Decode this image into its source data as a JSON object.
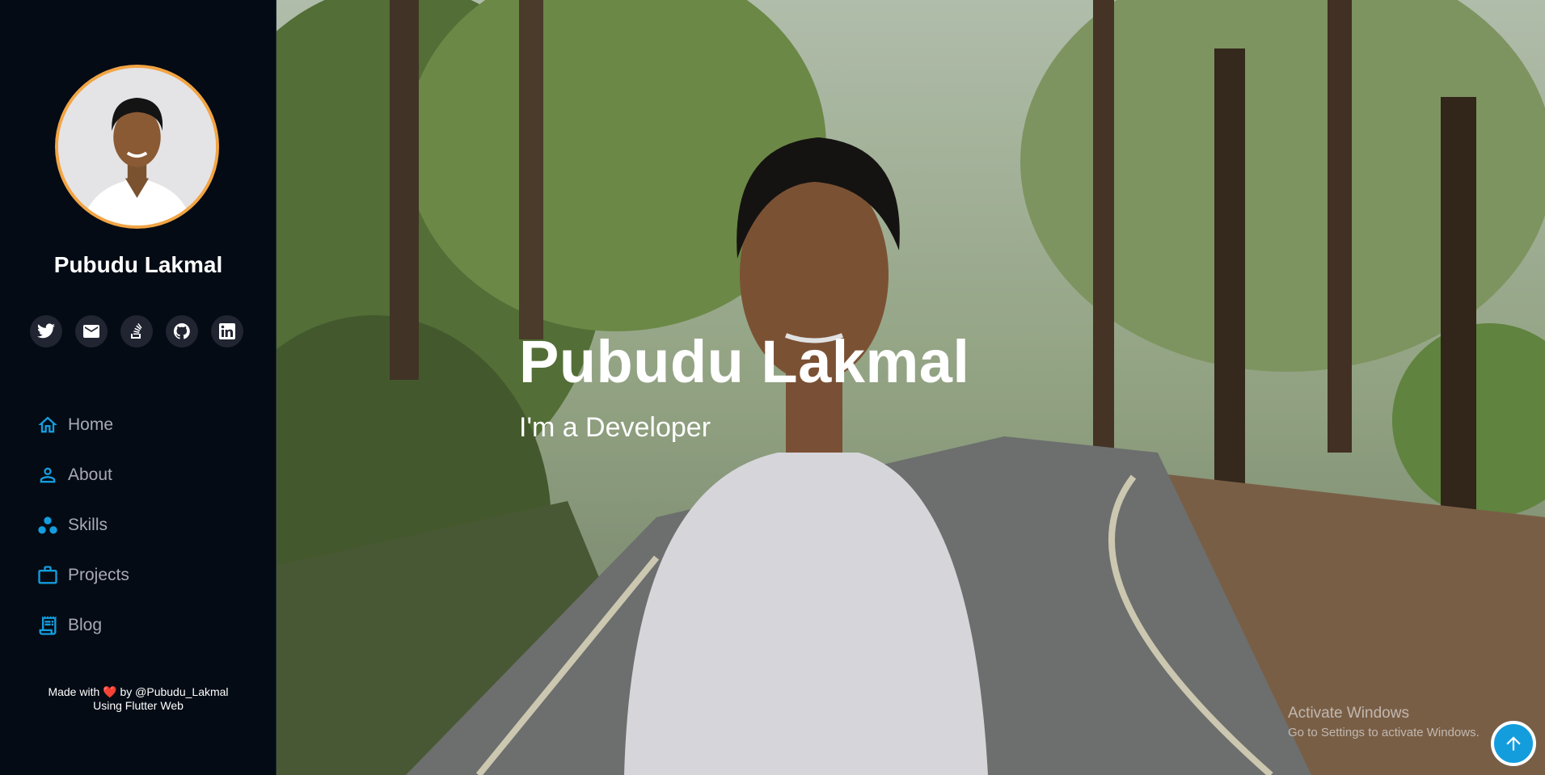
{
  "profile": {
    "name": "Pubudu Lakmal"
  },
  "social": [
    {
      "name": "twitter",
      "icon": "twitter-icon"
    },
    {
      "name": "email",
      "icon": "mail-icon"
    },
    {
      "name": "stackoverflow",
      "icon": "stackoverflow-icon"
    },
    {
      "name": "github",
      "icon": "github-icon"
    },
    {
      "name": "linkedin",
      "icon": "linkedin-icon"
    }
  ],
  "nav": {
    "home": {
      "label": "Home",
      "icon": "home-icon"
    },
    "about": {
      "label": "About",
      "icon": "person-icon"
    },
    "skills": {
      "label": "Skills",
      "icon": "workspaces-icon"
    },
    "projects": {
      "label": "Projects",
      "icon": "briefcase-icon"
    },
    "blog": {
      "label": "Blog",
      "icon": "receipt-icon"
    }
  },
  "footer": {
    "made_with": "Made with",
    "heart": "❤️",
    "by": "by @Pubudu_Lakmal",
    "tech": "Using Flutter Web"
  },
  "hero": {
    "title": "Pubudu Lakmal",
    "subtitle": "I'm a Developer"
  },
  "watermark": {
    "line1": "Activate Windows",
    "line2": "Go to Settings to activate Windows."
  },
  "colors": {
    "sidebar_bg": "#040b14",
    "accent": "#149ddd",
    "avatar_ring": "#f2a444",
    "nav_text": "#a8a9b4"
  }
}
